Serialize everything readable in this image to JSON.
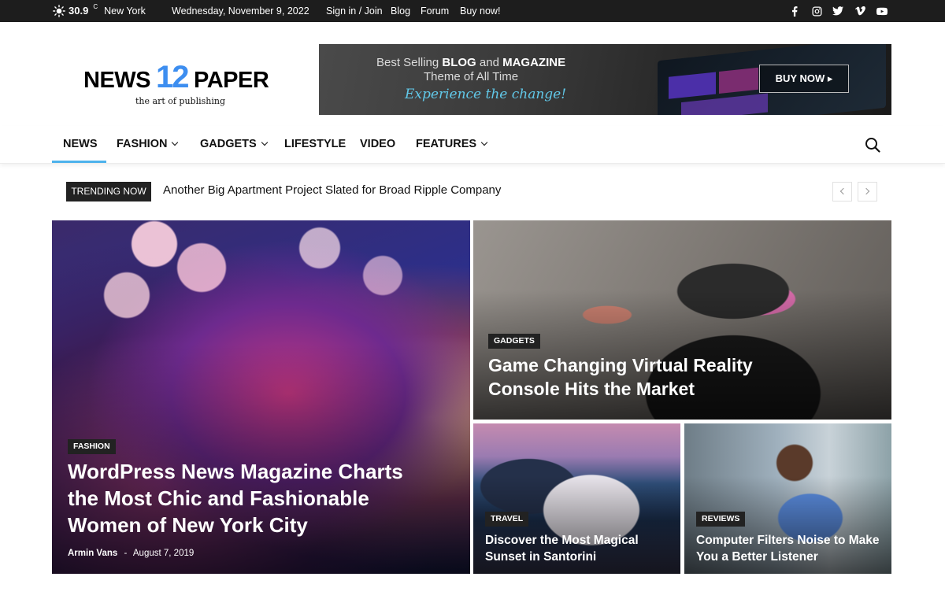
{
  "topbar": {
    "temperature": "30.9",
    "temp_unit": "C",
    "city": "New York",
    "date": "Wednesday, November 9, 2022",
    "links": [
      "Sign in / Join",
      "Blog",
      "Forum",
      "Buy now!"
    ],
    "social_icons": [
      "facebook-icon",
      "instagram-icon",
      "twitter-icon",
      "vimeo-icon",
      "youtube-icon"
    ]
  },
  "logo": {
    "word1": "NEWS",
    "number": "12",
    "word2": "PAPER",
    "tagline": "the art of publishing",
    "accent_color": "#3d8ef0"
  },
  "banner": {
    "line1_a": "Best Selling ",
    "line1_b": "BLOG",
    "line1_c": " and ",
    "line1_d": "MAGAZINE",
    "line2": "Theme of All Time",
    "line3": "Experience the change!",
    "button": "BUY NOW ▸"
  },
  "nav": {
    "items": [
      {
        "label": "NEWS",
        "has_dropdown": false,
        "active": true
      },
      {
        "label": "FASHION",
        "has_dropdown": true
      },
      {
        "label": "GADGETS",
        "has_dropdown": true
      },
      {
        "label": "LIFESTYLE",
        "has_dropdown": false
      },
      {
        "label": "VIDEO",
        "has_dropdown": false
      },
      {
        "label": "FEATURES",
        "has_dropdown": true
      }
    ],
    "active_color": "#4db2ec"
  },
  "trending": {
    "label": "TRENDING NOW",
    "headline": "Another Big Apartment Project Slated for Broad Ripple Company"
  },
  "featured": {
    "main": {
      "category": "FASHION",
      "title_lines": [
        "WordPress News Magazine Charts",
        "the Most Chic and Fashionable",
        "Women of New York City"
      ],
      "author": "Armin Vans",
      "separator": "-",
      "date": "August 7, 2019"
    },
    "top_right": {
      "category": "GADGETS",
      "title_lines": [
        "Game Changing Virtual Reality",
        "Console Hits the Market"
      ]
    },
    "bottom_left": {
      "category": "TRAVEL",
      "title_lines": [
        "Discover the Most Magical",
        "Sunset in Santorini"
      ]
    },
    "bottom_right": {
      "category": "REVIEWS",
      "title_lines": [
        "Computer Filters Noise to Make",
        "You a Better Listener"
      ]
    }
  }
}
